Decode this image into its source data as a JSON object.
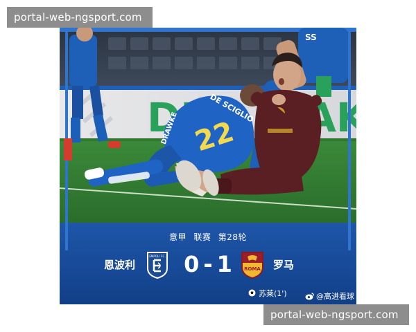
{
  "watermark": {
    "top": "portal-web-ngsport.com",
    "bottom": "portal-web-ngsport.com"
  },
  "photo": {
    "banner_text": "DE",
    "banner_text_right": "AK",
    "player_left_shirt": "DE SCIGLIO",
    "player_left_number": "22",
    "player_left_back_text": "DRAWKE",
    "colors": {
      "empoli_blue": "#1e5fb8",
      "roma_maroon": "#5a1f23",
      "pitch": "#2f7a2f"
    }
  },
  "match": {
    "competition": "意甲",
    "stage": "联赛",
    "round": "第28轮",
    "home_team": "恩波利",
    "away_team": "罗马",
    "home_score": "0",
    "separator": "-",
    "away_score": "1",
    "home_crest": "empoli-crest",
    "away_crest": "roma-crest",
    "home_crest_text": "EMPOLI F.C.",
    "away_crest_text": "ROMA",
    "scorer": "苏莱(1')",
    "credit": "@高进看球"
  }
}
